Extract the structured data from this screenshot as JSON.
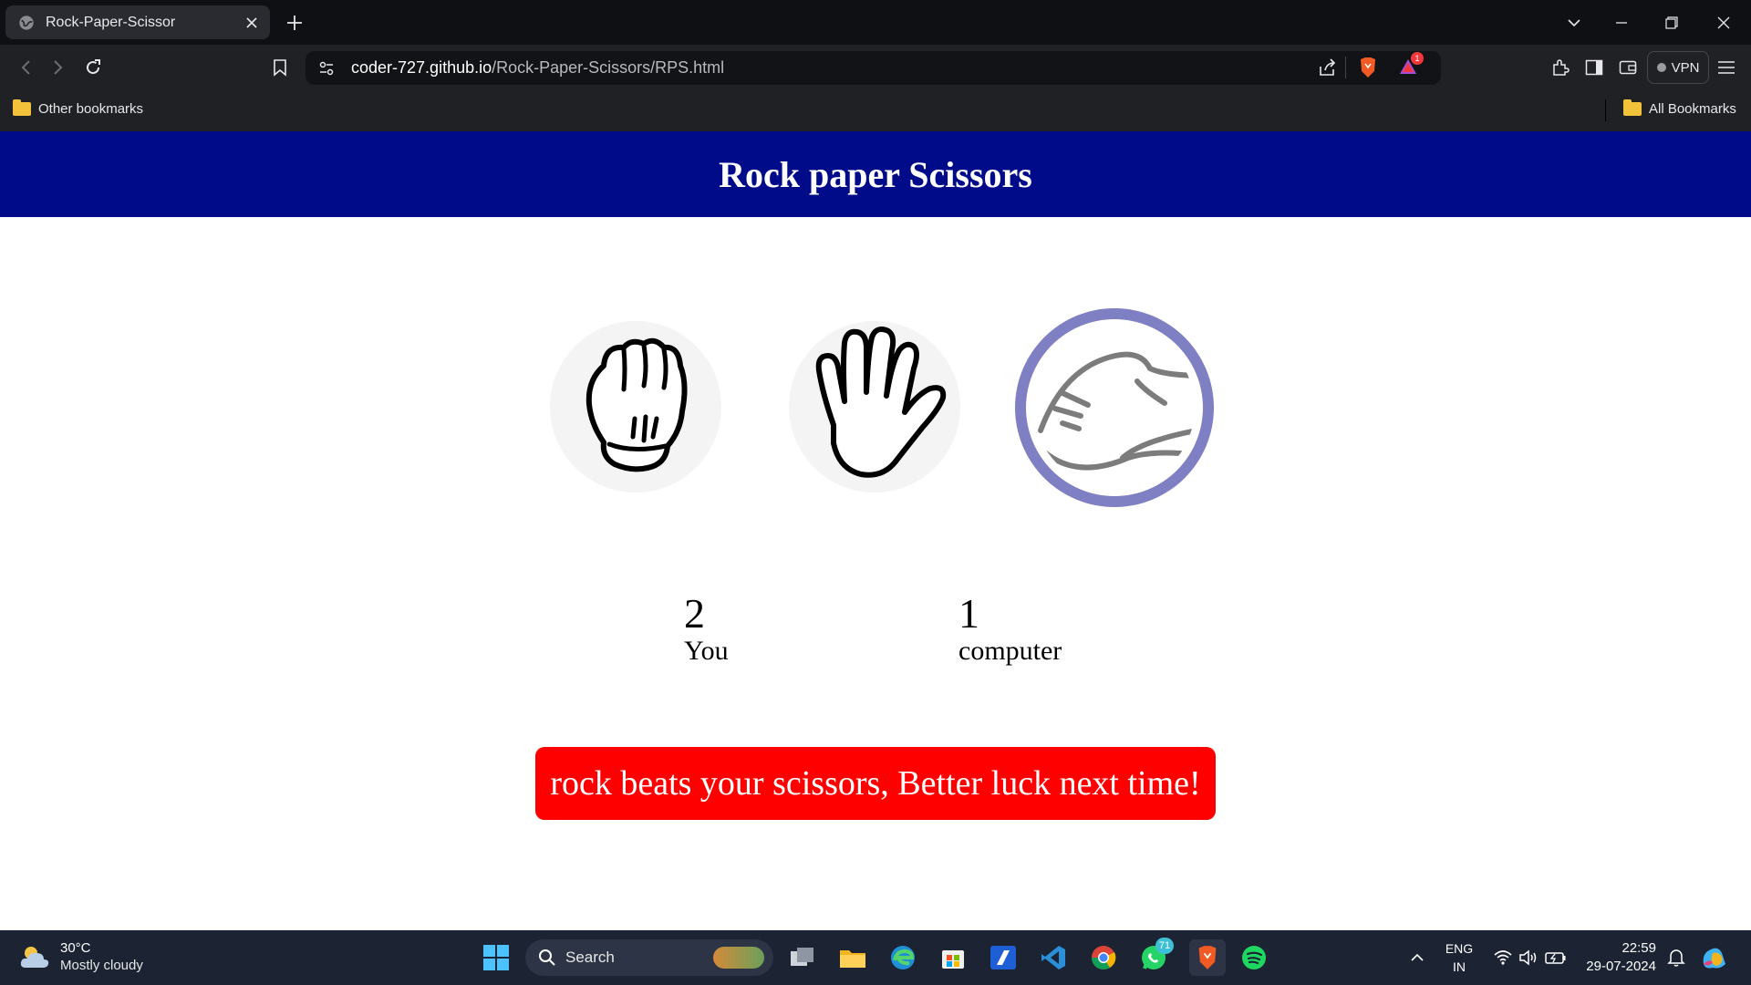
{
  "browser": {
    "tab_title": "Rock-Paper-Scissor",
    "url_host": "coder-727.github.io",
    "url_path": "/Rock-Paper-Scissors/RPS.html",
    "vpn_label": "VPN",
    "alert_badge": "1",
    "bookmarks_left": "Other bookmarks",
    "bookmarks_right": "All Bookmarks"
  },
  "page": {
    "title": "Rock paper Scissors",
    "choices": [
      {
        "name": "rock",
        "icon": "fist-icon",
        "selected": false
      },
      {
        "name": "paper",
        "icon": "open-hand-icon",
        "selected": false
      },
      {
        "name": "scissors",
        "icon": "scissors-hand-icon",
        "selected": true
      }
    ],
    "user_score": "2",
    "user_label": "You",
    "comp_score": "1",
    "comp_label": "computer",
    "message": "rock beats your scissors, Better luck next time!",
    "message_color": "#ff0000",
    "banner_color": "#000b8a",
    "selected_ring_color": "#7f7fc4"
  },
  "taskbar": {
    "temperature": "30°C",
    "weather": "Mostly cloudy",
    "search_placeholder": "Search",
    "whatsapp_badge": "71",
    "lang_line1": "ENG",
    "lang_line2": "IN",
    "time": "22:59",
    "date": "29-07-2024"
  }
}
